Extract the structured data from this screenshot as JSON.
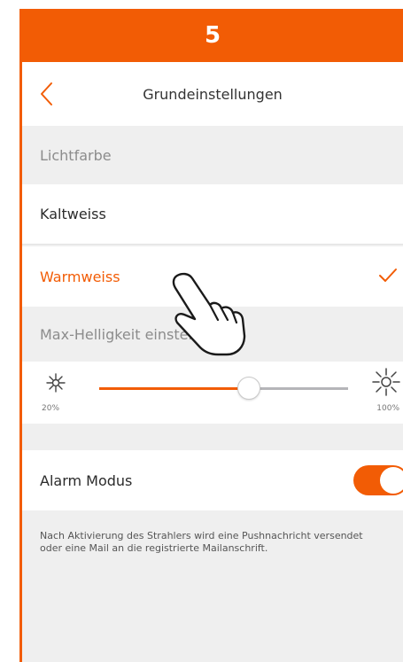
{
  "step": {
    "number": "5",
    "color": "#f25c05"
  },
  "navbar": {
    "back_icon": "chevron-left-icon",
    "title": "Grundeinstellungen"
  },
  "light_color": {
    "header": "Lichtfarbe",
    "options": [
      {
        "label": "Kaltweiss",
        "selected": false
      },
      {
        "label": "Warmweiss",
        "selected": true,
        "indicator": "checkmark-icon"
      }
    ]
  },
  "brightness": {
    "header": "Max-Helligkeit einstellen",
    "min_label": "20%",
    "max_label": "100%",
    "value_fraction": 0.6,
    "min_icon": "sun-small-icon",
    "max_icon": "sun-large-icon"
  },
  "alarm": {
    "label": "Alarm Modus",
    "enabled": true
  },
  "info": {
    "line1": "Nach Aktivierung des Strahlers wird eine Pushnachricht versendet",
    "line2": "oder eine Mail an die registrierte Mailanschrift."
  },
  "overlay": {
    "icon": "tap-hand-icon"
  }
}
